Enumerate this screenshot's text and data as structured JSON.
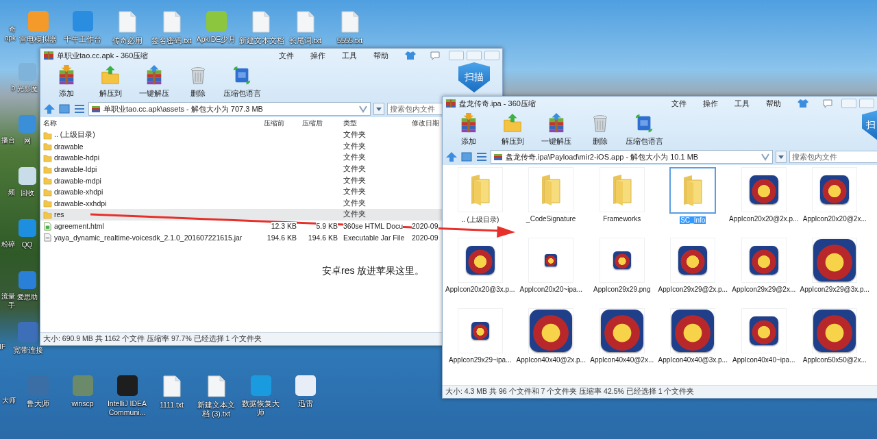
{
  "desktop": {
    "top_row": [
      {
        "label": "奇 apk",
        "kind": "partial"
      },
      {
        "label": "雷电模拟器",
        "kind": "app",
        "color": "#f39a2b"
      },
      {
        "label": "千牛工作台",
        "kind": "app",
        "color": "#2b8de0"
      },
      {
        "label": "传奇必用",
        "kind": "file"
      },
      {
        "label": "签名密码.txt",
        "kind": "file"
      },
      {
        "label": "ApkIDE少月",
        "kind": "app",
        "color": "#8cc63f"
      },
      {
        "label": "新建文本文档",
        "kind": "file"
      },
      {
        "label": "长尾词.txt",
        "kind": "file"
      },
      {
        "label": "5555.txt",
        "kind": "file"
      }
    ],
    "left_columns": [
      [
        {
          "label": "b",
          "kind": "partial"
        },
        {
          "label": "播台",
          "kind": "partial"
        },
        {
          "label": "频",
          "kind": "partial"
        },
        {
          "label": "粉碎",
          "kind": "partial"
        },
        {
          "label": "流量手",
          "kind": "partial"
        }
      ],
      [
        {
          "label": "光影魔",
          "kind": "app",
          "color": "#7fb3d9"
        },
        {
          "label": "网",
          "kind": "app",
          "color": "#3a8fd8"
        },
        {
          "label": "回收",
          "kind": "app",
          "color": "#c9dcea"
        },
        {
          "label": "QQ",
          "kind": "app",
          "color": "#1d8ee0"
        },
        {
          "label": "爱思助",
          "kind": "app",
          "color": "#2a7fd6"
        }
      ]
    ],
    "lower_row": [
      {
        "label": "IF",
        "kind": "partial"
      },
      {
        "label": "宽带连接",
        "kind": "app",
        "color": "#3d6fb8"
      }
    ],
    "bottom_row": [
      {
        "label": "大师",
        "kind": "partial"
      },
      {
        "label": "鲁大师",
        "kind": "app",
        "color": "#3a6ea5"
      },
      {
        "label": "winscp",
        "kind": "app",
        "color": "#6a8a6a"
      },
      {
        "label": "IntelliJ IDEA Communi...",
        "kind": "app",
        "color": "#1e1e1e"
      },
      {
        "label": "1111.txt",
        "kind": "file"
      },
      {
        "label": "新建文本文档 (3).txt",
        "kind": "file"
      },
      {
        "label": "数据恢复大师",
        "kind": "app",
        "color": "#1a9be0"
      },
      {
        "label": "迅雷",
        "kind": "app",
        "color": "#e8eef8"
      }
    ]
  },
  "left_window": {
    "title": "单职业tao.cc.apk - 360压缩",
    "menu": [
      "文件",
      "操作",
      "工具",
      "帮助"
    ],
    "toolbar": [
      {
        "label": "添加",
        "kind": "add"
      },
      {
        "label": "解压到",
        "kind": "extract"
      },
      {
        "label": "一键解压",
        "kind": "quick"
      },
      {
        "label": "删除",
        "kind": "delete"
      },
      {
        "label": "压缩包语言",
        "kind": "language"
      }
    ],
    "scan_label": "扫描",
    "address": "单职业tao.cc.apk\\assets - 解包大小为 707.3 MB",
    "search": {
      "placeholder": "搜索包内文件"
    },
    "columns": [
      "名称",
      "压缩前",
      "压缩后",
      "类型",
      "修改日期"
    ],
    "rows": [
      {
        "name": ".. (上级目录)",
        "kind": "folder",
        "type": "文件夹",
        "selected": false
      },
      {
        "name": "drawable",
        "kind": "folder",
        "type": "文件夹",
        "selected": false
      },
      {
        "name": "drawable-hdpi",
        "kind": "folder",
        "type": "文件夹",
        "selected": false
      },
      {
        "name": "drawable-ldpi",
        "kind": "folder",
        "type": "文件夹",
        "selected": false
      },
      {
        "name": "drawable-mdpi",
        "kind": "folder",
        "type": "文件夹",
        "selected": false
      },
      {
        "name": "drawable-xhdpi",
        "kind": "folder",
        "type": "文件夹",
        "selected": false
      },
      {
        "name": "drawable-xxhdpi",
        "kind": "folder",
        "type": "文件夹",
        "selected": false
      },
      {
        "name": "res",
        "kind": "folder",
        "type": "文件夹",
        "selected": true
      },
      {
        "name": "agreement.html",
        "kind": "html",
        "size": "12.3 KB",
        "packed": "5.9 KB",
        "type": "360se HTML Docu",
        "modified": "2020-09",
        "selected": false
      },
      {
        "name": "yaya_dynamic_realtime-voicesdk_2.1.0_201607221615.jar",
        "kind": "jar",
        "size": "194.6 KB",
        "packed": "194.6 KB",
        "type": "Executable Jar File",
        "modified": "2020-09",
        "selected": false
      }
    ],
    "status": "大小: 690.9 MB 共 1162 个文件 压缩率 97.7% 已经选择 1 个文件夹"
  },
  "annotation": "安卓res 放进苹果这里。",
  "right_window": {
    "title": "盘龙传奇.ipa - 360压缩",
    "menu": [
      "文件",
      "操作",
      "工具",
      "帮助"
    ],
    "toolbar": [
      {
        "label": "添加",
        "kind": "add"
      },
      {
        "label": "解压到",
        "kind": "extract"
      },
      {
        "label": "一键解压",
        "kind": "quick"
      },
      {
        "label": "删除",
        "kind": "delete"
      },
      {
        "label": "压缩包语言",
        "kind": "language"
      }
    ],
    "scan_label": "扫",
    "address": "盘龙传奇.ipa\\Payload\\mir2-iOS.app - 解包大小为 10.1 MB",
    "search": {
      "placeholder": "搜索包内文件"
    },
    "items": [
      {
        "name": ".. (上级目录)",
        "kind": "folder",
        "selected": false
      },
      {
        "name": "_CodeSignature",
        "kind": "folder",
        "selected": false
      },
      {
        "name": "Frameworks",
        "kind": "folder",
        "selected": false
      },
      {
        "name": "SC_Info",
        "kind": "folder",
        "selected": true
      },
      {
        "name": "AppIcon20x20@2x.p...",
        "kind": "medium",
        "selected": false
      },
      {
        "name": "AppIcon20x20@2x...",
        "kind": "medium",
        "selected": false
      },
      {
        "name": "AppIcon20x20@3x.p...",
        "kind": "medium",
        "selected": false
      },
      {
        "name": "AppIcon20x20~ipa...",
        "kind": "tiny",
        "selected": false
      },
      {
        "name": "AppIcon29x29.png",
        "kind": "small",
        "selected": false
      },
      {
        "name": "AppIcon29x29@2x.p...",
        "kind": "medium",
        "selected": false
      },
      {
        "name": "AppIcon29x29@2x...",
        "kind": "medium",
        "selected": false
      },
      {
        "name": "AppIcon29x29@3x.p...",
        "kind": "large",
        "selected": false
      },
      {
        "name": "AppIcon29x29~ipa...",
        "kind": "small",
        "selected": false
      },
      {
        "name": "AppIcon40x40@2x.p...",
        "kind": "large",
        "selected": false
      },
      {
        "name": "AppIcon40x40@2x...",
        "kind": "large",
        "selected": false
      },
      {
        "name": "AppIcon40x40@3x.p...",
        "kind": "large",
        "selected": false
      },
      {
        "name": "AppIcon40x40~ipa...",
        "kind": "medium",
        "selected": false
      },
      {
        "name": "AppIcon50x50@2x...",
        "kind": "large",
        "selected": false
      }
    ],
    "status": "大小: 4.3 MB 共 96 个文件和 7 个文件夹 压缩率 42.5% 已经选择 1 个文件夹"
  }
}
